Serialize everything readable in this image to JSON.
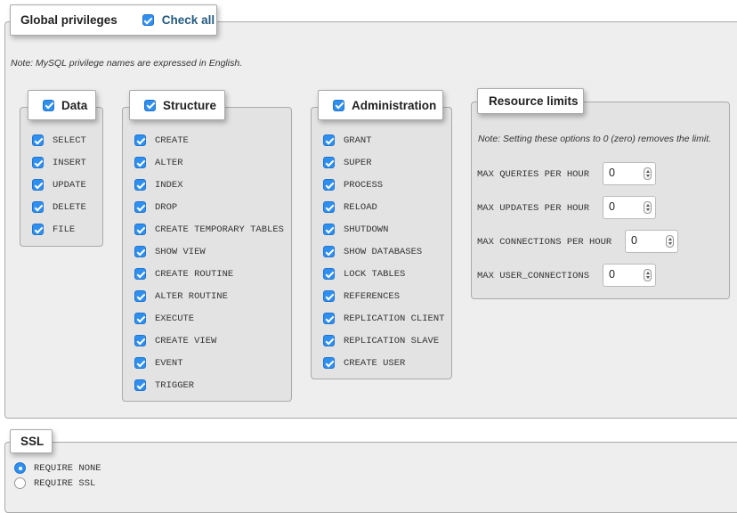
{
  "global": {
    "title": "Global privileges",
    "check_all_label": "Check all",
    "note": "Note: MySQL privilege names are expressed in English."
  },
  "data_group": {
    "title": "Data",
    "items": [
      "SELECT",
      "INSERT",
      "UPDATE",
      "DELETE",
      "FILE"
    ]
  },
  "structure_group": {
    "title": "Structure",
    "items": [
      "CREATE",
      "ALTER",
      "INDEX",
      "DROP",
      "CREATE TEMPORARY TABLES",
      "SHOW VIEW",
      "CREATE ROUTINE",
      "ALTER ROUTINE",
      "EXECUTE",
      "CREATE VIEW",
      "EVENT",
      "TRIGGER"
    ]
  },
  "admin_group": {
    "title": "Administration",
    "items": [
      "GRANT",
      "SUPER",
      "PROCESS",
      "RELOAD",
      "SHUTDOWN",
      "SHOW DATABASES",
      "LOCK TABLES",
      "REFERENCES",
      "REPLICATION CLIENT",
      "REPLICATION SLAVE",
      "CREATE USER"
    ]
  },
  "resource_limits": {
    "title": "Resource limits",
    "note": "Note: Setting these options to 0 (zero) removes the limit.",
    "fields": [
      {
        "label": "MAX QUERIES PER HOUR",
        "value": "0"
      },
      {
        "label": "MAX UPDATES PER HOUR",
        "value": "0"
      },
      {
        "label": "MAX CONNECTIONS PER HOUR",
        "value": "0"
      },
      {
        "label": "MAX USER_CONNECTIONS",
        "value": "0"
      }
    ]
  },
  "ssl": {
    "title": "SSL",
    "options": [
      {
        "label": "REQUIRE NONE",
        "selected": true
      },
      {
        "label": "REQUIRE SSL",
        "selected": false
      }
    ]
  },
  "colors": {
    "accent": "#2f8ff0",
    "panel_bg": "#eeeeee",
    "group_bg": "#e3e3e3"
  }
}
